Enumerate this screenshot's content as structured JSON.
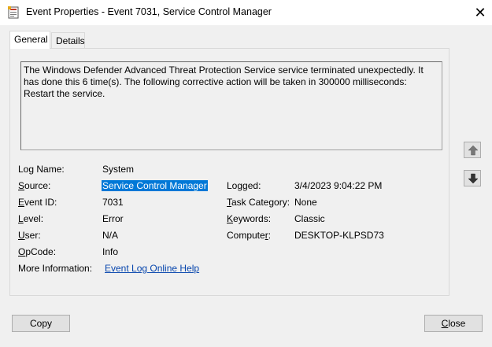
{
  "window": {
    "title": "Event Properties - Event 7031, Service Control Manager",
    "close_icon": "close-icon",
    "app_icon": "event-viewer-icon"
  },
  "tabs": [
    {
      "label": "General",
      "active": true
    },
    {
      "label": "Details",
      "active": false
    }
  ],
  "description": "The Windows Defender Advanced Threat Protection Service service terminated unexpectedly.  It\nhas done this 6 time(s).  The following corrective action will be taken in 300000 milliseconds:\nRestart the service.",
  "fields": {
    "log_name": {
      "label": "Log Name:",
      "value": "System"
    },
    "source": {
      "label": "Source:",
      "value": "Service Control Manager"
    },
    "logged": {
      "label": "Logged:",
      "value": "3/4/2023 9:04:22 PM"
    },
    "event_id": {
      "label": "Event ID:",
      "value": "7031"
    },
    "task_category": {
      "label": "Task Category:",
      "value": "None"
    },
    "level": {
      "label": "Level:",
      "value": "Error"
    },
    "keywords": {
      "label": "Keywords:",
      "value": "Classic"
    },
    "user": {
      "label": "User:",
      "value": "N/A"
    },
    "computer": {
      "label": "Computer:",
      "value": "DESKTOP-KLPSD73"
    },
    "opcode": {
      "label": "OpCode:",
      "value": "Info"
    },
    "more_info": {
      "label": "More Information:",
      "link": "Event Log Online Help"
    }
  },
  "buttons": {
    "copy": "Copy",
    "close": "Close",
    "up_icon": "arrow-up-icon",
    "down_icon": "arrow-down-icon"
  }
}
